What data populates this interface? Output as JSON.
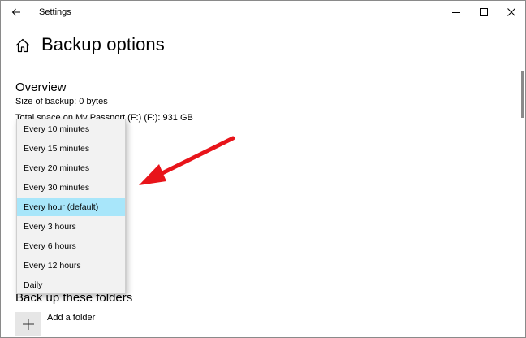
{
  "window": {
    "title": "Settings",
    "controls": {
      "minimize": "minimize-icon",
      "maximize": "maximize-icon",
      "close": "close-icon"
    }
  },
  "header": {
    "title": "Backup options"
  },
  "overview": {
    "heading": "Overview",
    "size_of_backup": "Size of backup: 0 bytes",
    "total_space": "Total space on My Passport (F:) (F:): 931 GB"
  },
  "dropdown": {
    "options": [
      "Every 10 minutes",
      "Every 15 minutes",
      "Every 20 minutes",
      "Every 30 minutes",
      "Every hour (default)",
      "Every 3 hours",
      "Every 6 hours",
      "Every 12 hours",
      "Daily"
    ],
    "selected": "Every hour (default)"
  },
  "folders": {
    "heading": "Back up these folders",
    "add_folder_label": "Add a folder"
  },
  "colors": {
    "selection": "#a8e6fa",
    "annotation_arrow": "#e8141a",
    "dropdown_bg": "#f2f2f2"
  }
}
